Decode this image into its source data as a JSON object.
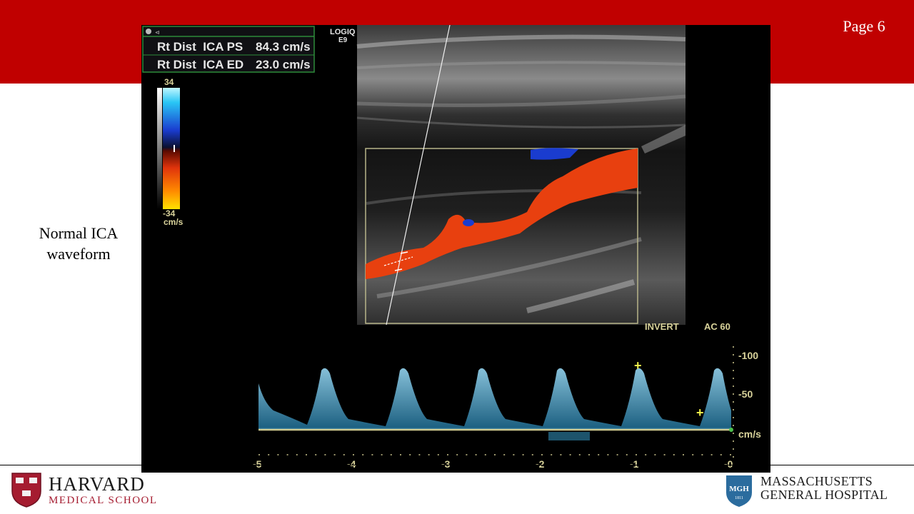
{
  "slide": {
    "page_label": "Page 6",
    "caption_line1": "Normal ICA",
    "caption_line2": "waveform"
  },
  "ultrasound": {
    "scanner": {
      "line1": "LOGIQ",
      "line2": "E9"
    },
    "measurements": [
      {
        "label": "Rt Dist  ICA PS",
        "value": "84.3 cm/s"
      },
      {
        "label": "Rt Dist  ICA ED",
        "value": "23.0 cm/s"
      }
    ],
    "color_scale": {
      "max": "34",
      "min": "-34",
      "unit": "cm/s"
    },
    "doppler_settings": {
      "invert": "INVERT",
      "ac": "AC 60"
    },
    "velocity_axis": {
      "ticks": [
        "-100",
        "-50"
      ],
      "unit": "cm/s"
    },
    "time_axis": {
      "ticks": [
        "-5",
        "-4",
        "-3",
        "-2",
        "-1",
        "-0"
      ]
    }
  },
  "logos": {
    "harvard": {
      "name": "HARVARD",
      "sub": "MEDICAL SCHOOL"
    },
    "mgh": {
      "badge": "MGH",
      "year": "1811",
      "line1": "MASSACHUSETTS",
      "line2": "GENERAL HOSPITAL"
    }
  },
  "colors": {
    "banner": "#c00000",
    "harvard_crimson": "#a51c30",
    "mgh_blue": "#2b6c9e",
    "flow_red": "#e8400f",
    "flow_blue": "#1a3ccf",
    "overlay_text": "#d8d29a",
    "spectral_blue": "#5ab8e6"
  }
}
